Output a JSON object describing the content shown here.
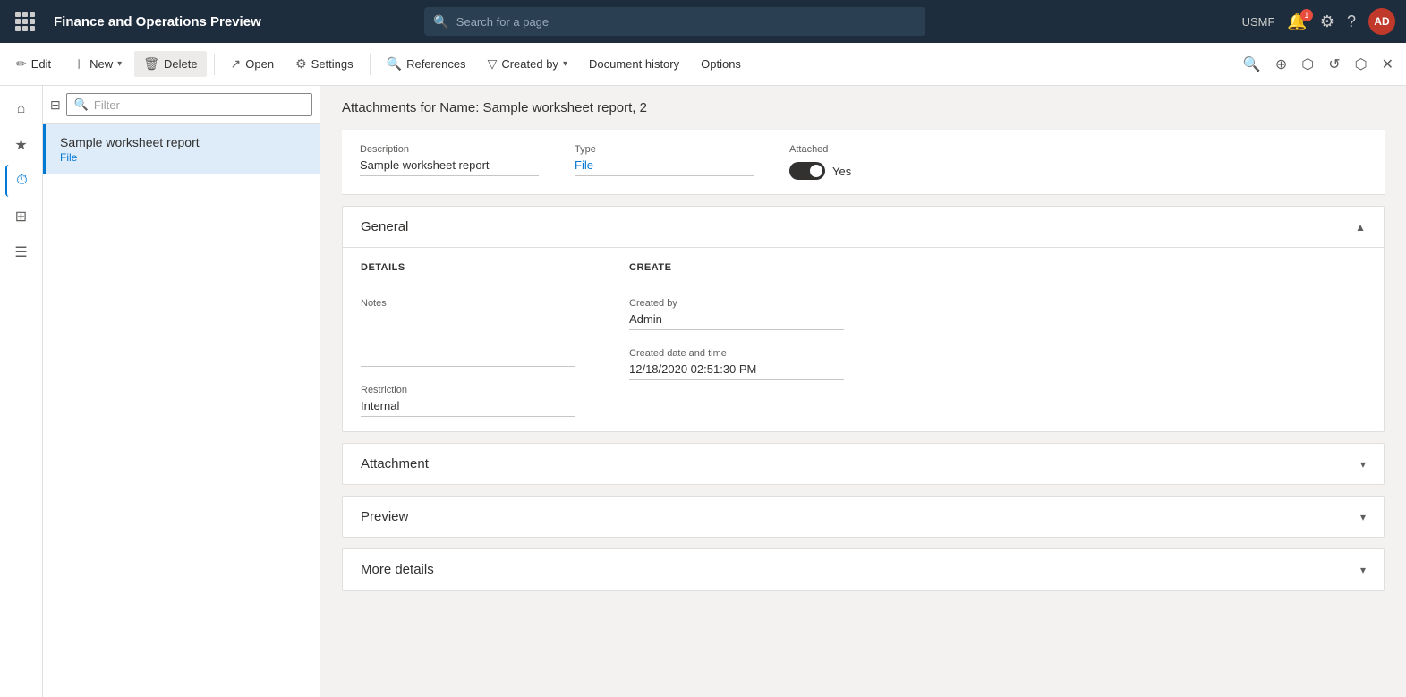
{
  "topbar": {
    "app_title": "Finance and Operations Preview",
    "search_placeholder": "Search for a page",
    "user_label": "USMF",
    "avatar_initials": "AD"
  },
  "actionbar": {
    "edit_label": "Edit",
    "new_label": "New",
    "delete_label": "Delete",
    "open_label": "Open",
    "settings_label": "Settings",
    "references_label": "References",
    "created_by_label": "Created by",
    "document_history_label": "Document history",
    "options_label": "Options"
  },
  "sidebar": {
    "items": [
      {
        "icon": "⌂",
        "name": "home"
      },
      {
        "icon": "★",
        "name": "favorites"
      },
      {
        "icon": "⊞",
        "name": "workspaces"
      },
      {
        "icon": "☰",
        "name": "nav"
      }
    ]
  },
  "list": {
    "filter_placeholder": "Filter",
    "items": [
      {
        "title": "Sample worksheet report",
        "sub": "File",
        "selected": true
      }
    ]
  },
  "detail": {
    "header": "Attachments for Name: Sample worksheet report, 2",
    "description_label": "Description",
    "description_value": "Sample worksheet report",
    "type_label": "Type",
    "type_value": "File",
    "attached_label": "Attached",
    "attached_value": "Yes",
    "sections": {
      "general": {
        "title": "General",
        "expanded": true,
        "details_col_title": "DETAILS",
        "create_col_title": "CREATE",
        "notes_label": "Notes",
        "notes_value": "",
        "restriction_label": "Restriction",
        "restriction_value": "Internal",
        "created_by_label": "Created by",
        "created_by_value": "Admin",
        "created_date_label": "Created date and time",
        "created_date_value": "12/18/2020 02:51:30 PM"
      },
      "attachment": {
        "title": "Attachment"
      },
      "preview": {
        "title": "Preview"
      },
      "more_details": {
        "title": "More details"
      }
    }
  }
}
